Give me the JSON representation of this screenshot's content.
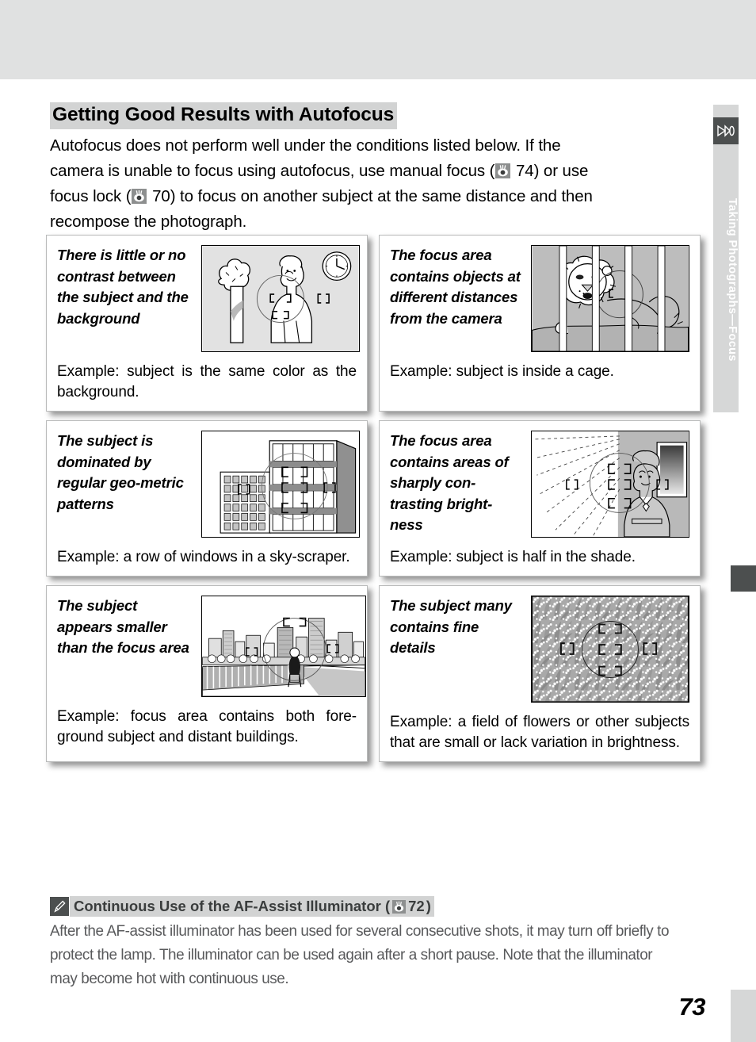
{
  "page": {
    "number": "73",
    "side_tab_label": "Taking Photographs—Focus",
    "side_tab_icon": "camera-lens-icon",
    "thumb_index_icon": "thumb-index-marker"
  },
  "heading": {
    "title": "Getting Good Results with Autofocus"
  },
  "intro": {
    "line1": "Autofocus does not perform well under the conditions listed below.  If the",
    "line2_a": "camera is unable to focus using autofocus, use manual focus (",
    "ref1": "74",
    "line2_b": ") or use",
    "line3_a": "focus lock (",
    "ref2": "70",
    "line3_b": ") to focus on another subject at the same distance and then",
    "line4": "recompose the photograph."
  },
  "cards": [
    {
      "condition": "There is little or no contrast between the subject and the background",
      "example": "Example: subject is the same color as the background.",
      "illustration": "woman-tree-clock-illustration"
    },
    {
      "condition": "The focus area contains objects at different distances from the camera",
      "example": "Example: subject is inside a cage.",
      "illustration": "lion-behind-cage-bars-illustration"
    },
    {
      "condition": "The subject is dominated by regular geo-metric patterns",
      "example": "Example: a row of windows in a sky-scraper.",
      "illustration": "skyscraper-windows-illustration"
    },
    {
      "condition": "The focus area contains areas of sharply con-trasting bright-ness",
      "example": "Example: subject is half in the shade.",
      "illustration": "woman-half-in-shade-illustration"
    },
    {
      "condition": "The subject appears smaller than the focus area",
      "example": "Example: focus area contains both fore-ground subject and distant buildings.",
      "illustration": "cityscape-bridge-person-illustration"
    },
    {
      "condition": "The subject many contains fine details",
      "example": "Example: a field of flowers or other subjects that are small or lack variation in brightness.",
      "illustration": "field-of-flowers-illustration"
    }
  ],
  "note": {
    "icon": "pencil-icon",
    "title_a": "Continuous Use of the AF-Assist Illuminator (",
    "title_ref": "72",
    "title_b": ")",
    "body": "After the AF-assist illuminator has been used for several consecutive shots, it may turn off briefly to protect the lamp.  The illuminator can be used again after a short pause.  Note that the illuminator may become hot with continuous use."
  },
  "colors": {
    "band_gray": "#e0e1e1",
    "highlight_gray": "#d2d3d3",
    "tab_gray": "#d6d7d7",
    "dark_gray": "#4c4f4f",
    "body_gray": "#58595b"
  }
}
